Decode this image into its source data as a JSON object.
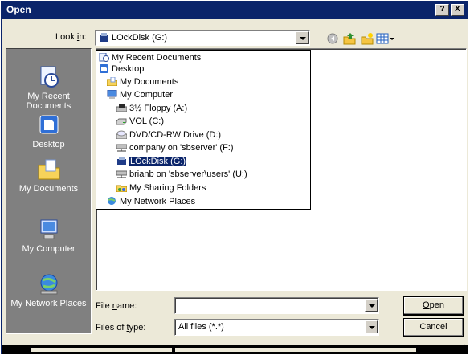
{
  "window": {
    "title": "Open",
    "help_button": "?",
    "close_button": "X"
  },
  "lookin": {
    "label_prefix": "Look ",
    "label_accel": "i",
    "label_suffix": "n:",
    "value": "LOckDisk (G:)"
  },
  "toolbar": {
    "icons": [
      "back-icon",
      "up-folder-icon",
      "new-folder-icon",
      "views-menu-icon"
    ]
  },
  "places": [
    {
      "label": "My Recent Documents",
      "icon": "recent-documents-icon"
    },
    {
      "label": "Desktop",
      "icon": "desktop-icon"
    },
    {
      "label": "My Documents",
      "icon": "my-documents-icon"
    },
    {
      "label": "My Computer",
      "icon": "my-computer-icon"
    },
    {
      "label": "My Network Places",
      "icon": "network-places-icon"
    }
  ],
  "dropdown": {
    "items": [
      {
        "label": "My Recent Documents",
        "icon": "recent-documents-icon",
        "selected": false
      },
      {
        "label": "Desktop",
        "icon": "desktop-icon",
        "selected": false
      },
      {
        "label": "My Documents",
        "icon": "my-documents-icon",
        "selected": false
      },
      {
        "label": "My Computer",
        "icon": "my-computer-icon",
        "selected": false
      },
      {
        "label": "3½ Floppy (A:)",
        "icon": "floppy-drive-icon",
        "selected": false
      },
      {
        "label": "VOL (C:)",
        "icon": "hard-drive-icon",
        "selected": false
      },
      {
        "label": "DVD/CD-RW Drive (D:)",
        "icon": "optical-drive-icon",
        "selected": false
      },
      {
        "label": "company on 'sbserver' (F:)",
        "icon": "network-drive-icon",
        "selected": false
      },
      {
        "label": "LOckDisk (G:)",
        "icon": "removable-drive-icon",
        "selected": true
      },
      {
        "label": "brianb on 'sbserver\\users' (U:)",
        "icon": "network-drive-icon",
        "selected": false
      },
      {
        "label": "My Sharing Folders",
        "icon": "shared-folders-icon",
        "selected": false
      },
      {
        "label": "My Network Places",
        "icon": "network-places-icon",
        "selected": false
      }
    ]
  },
  "filename": {
    "label_accel": "n",
    "label_prefix": "File ",
    "label_suffix": "ame:",
    "value": ""
  },
  "filetype": {
    "label_prefix": "Files of ",
    "label_accel": "t",
    "label_suffix": "ype:",
    "value": "All files (*.*)"
  },
  "buttons": {
    "open_accel": "O",
    "open_rest": "pen",
    "cancel": "Cancel"
  },
  "colors": {
    "title_bar": "#0a246a",
    "selection": "#0a246a",
    "places_bar": "#808080",
    "dialog_face": "#ece9d8"
  }
}
